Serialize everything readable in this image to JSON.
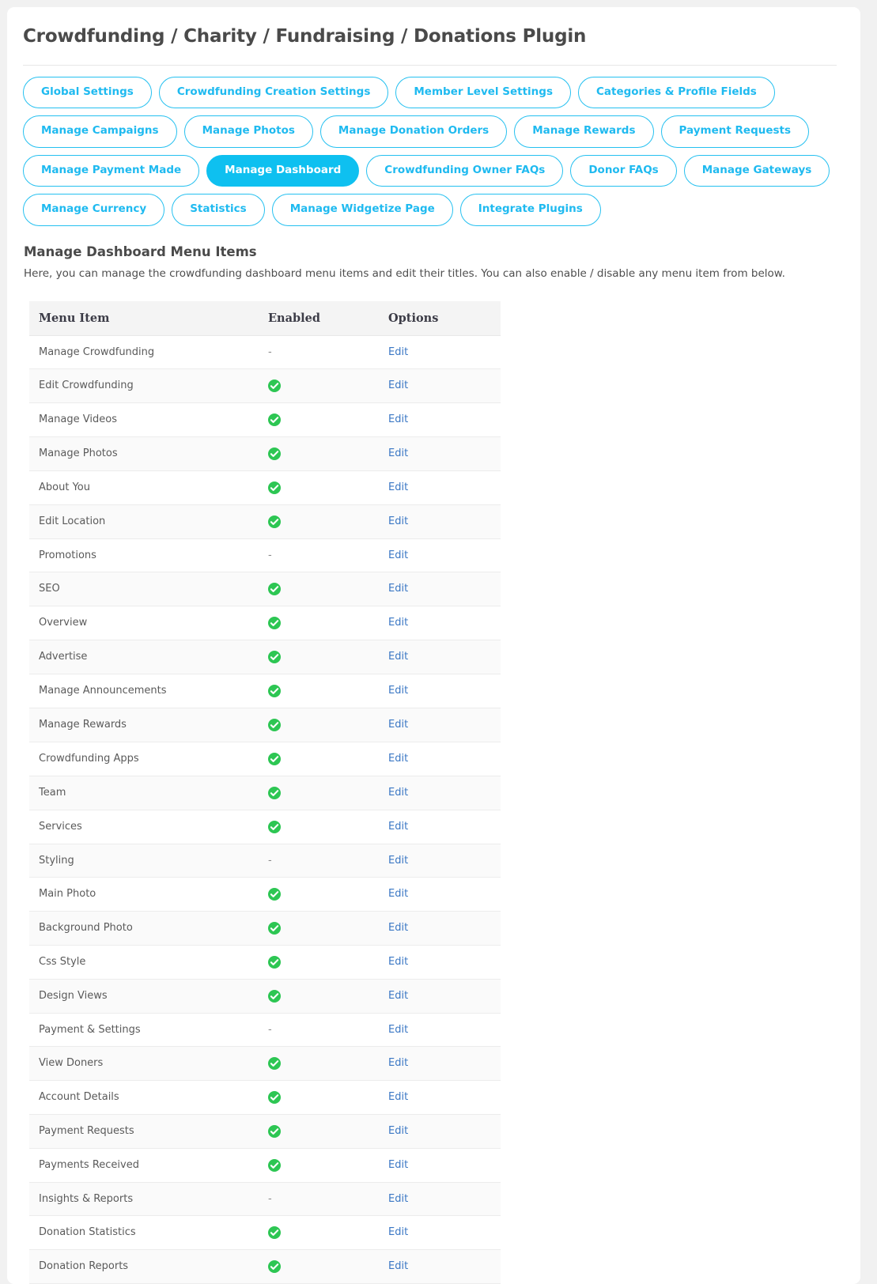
{
  "page": {
    "title": "Crowdfunding / Charity / Fundraising / Donations Plugin",
    "accent_color": "#0ec0f0",
    "check_color": "#2dc653",
    "link_color": "#3a77c4",
    "background_color": "#f1f1f1",
    "card_color": "#ffffff"
  },
  "tabs": [
    {
      "label": "Global Settings",
      "active": false
    },
    {
      "label": "Crowdfunding Creation Settings",
      "active": false
    },
    {
      "label": "Member Level Settings",
      "active": false
    },
    {
      "label": "Categories & Profile Fields",
      "active": false
    },
    {
      "label": "Manage Campaigns",
      "active": false
    },
    {
      "label": "Manage Photos",
      "active": false
    },
    {
      "label": "Manage Donation Orders",
      "active": false
    },
    {
      "label": "Manage Rewards",
      "active": false
    },
    {
      "label": "Payment Requests",
      "active": false
    },
    {
      "label": "Manage Payment Made",
      "active": false
    },
    {
      "label": "Manage Dashboard",
      "active": true
    },
    {
      "label": "Crowdfunding Owner FAQs",
      "active": false
    },
    {
      "label": "Donor FAQs",
      "active": false
    },
    {
      "label": "Manage Gateways",
      "active": false
    },
    {
      "label": "Manage Currency",
      "active": false
    },
    {
      "label": "Statistics",
      "active": false
    },
    {
      "label": "Manage Widgetize Page",
      "active": false
    },
    {
      "label": "Integrate Plugins",
      "active": false
    }
  ],
  "section": {
    "heading": "Manage Dashboard Menu Items",
    "description": "Here, you can manage the crowdfunding dashboard menu items and edit their titles. You can also enable / disable any menu item from below."
  },
  "table": {
    "columns": [
      "Menu Item",
      "Enabled",
      "Options"
    ],
    "edit_label": "Edit",
    "disabled_mark": "-",
    "enabled_icon": "check-circle-icon",
    "rows": [
      {
        "item": "Manage Crowdfunding",
        "enabled": false
      },
      {
        "item": "Edit Crowdfunding",
        "enabled": true
      },
      {
        "item": "Manage Videos",
        "enabled": true
      },
      {
        "item": "Manage Photos",
        "enabled": true
      },
      {
        "item": "About You",
        "enabled": true
      },
      {
        "item": "Edit Location",
        "enabled": true
      },
      {
        "item": "Promotions",
        "enabled": false
      },
      {
        "item": "SEO",
        "enabled": true
      },
      {
        "item": "Overview",
        "enabled": true
      },
      {
        "item": "Advertise",
        "enabled": true
      },
      {
        "item": "Manage Announcements",
        "enabled": true
      },
      {
        "item": "Manage Rewards",
        "enabled": true
      },
      {
        "item": "Crowdfunding Apps",
        "enabled": true
      },
      {
        "item": "Team",
        "enabled": true
      },
      {
        "item": "Services",
        "enabled": true
      },
      {
        "item": "Styling",
        "enabled": false
      },
      {
        "item": "Main Photo",
        "enabled": true
      },
      {
        "item": "Background Photo",
        "enabled": true
      },
      {
        "item": "Css Style",
        "enabled": true
      },
      {
        "item": "Design Views",
        "enabled": true
      },
      {
        "item": "Payment & Settings",
        "enabled": false
      },
      {
        "item": "View Doners",
        "enabled": true
      },
      {
        "item": "Account Details",
        "enabled": true
      },
      {
        "item": "Payment Requests",
        "enabled": true
      },
      {
        "item": "Payments Received",
        "enabled": true
      },
      {
        "item": "Insights & Reports",
        "enabled": false
      },
      {
        "item": "Donation Statistics",
        "enabled": true
      },
      {
        "item": "Donation Reports",
        "enabled": true
      }
    ]
  }
}
